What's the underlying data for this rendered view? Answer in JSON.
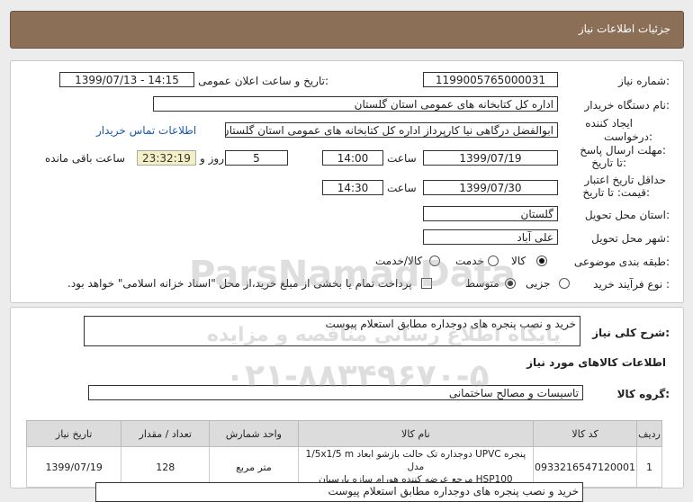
{
  "header": {
    "title": "جزئیات اطلاعات نیاز"
  },
  "fields": {
    "need_number_label": "شماره نیاز:",
    "need_number": "1199005765000031",
    "announce_label": "تاریخ و ساعت اعلان عمومی:",
    "announce_value": "1399/07/13 - 14:15",
    "buyer_label": "نام دستگاه خریدار:",
    "buyer_value": "اداره کل کتابخانه های عمومی استان گلستان",
    "creator_label_1": "ایجاد کننده",
    "creator_label_2": "درخواست:",
    "creator_value": "ابوالفضل  درگاهی نیا کارپرداز اداره کل کتابخانه های عمومی استان گلستان",
    "contact_link": "اطلاعات تماس خریدار",
    "deadline_label_1": "مهلت ارسال پاسخ:",
    "deadline_label_2": "تا تاریخ:",
    "deadline_date": "1399/07/19",
    "time_label": "ساعت",
    "deadline_time": "14:00",
    "days_value": "5",
    "days_label": "روز و",
    "remaining_time": "23:32:19",
    "remaining_label": "ساعت باقی مانده",
    "validity_label_1": "حداقل تاریخ اعتبار",
    "validity_label_2": "قیمت: تا تاریخ:",
    "validity_date": "1399/07/30",
    "validity_time_label": "ساعت",
    "validity_time": "14:30",
    "province_label": "استان محل تحویل:",
    "province_value": "گلستان",
    "city_label": "شهر محل تحویل:",
    "city_value": "علی آباد",
    "category_label": "طبقه بندی موضوعی:",
    "category_options": [
      "کالا",
      "خدمت",
      "کالا/خدمت"
    ],
    "category_selected": "کالا",
    "process_label": "نوع فرآیند خرید :",
    "process_options": [
      "جزیی",
      "متوسط"
    ],
    "process_selected": "متوسط",
    "payment_note": "پرداخت تمام یا بخشی از مبلغ خرید،از محل \"اسناد خزانه اسلامی\" خواهد بود."
  },
  "summary": {
    "label": "شرح کلی نیاز:",
    "value": "خرید و نصب پنجره های دوجداره مطابق استعلام پیوست"
  },
  "goods": {
    "section_title": "اطلاعات کالاهای مورد نیاز",
    "group_label": "گروه کالا:",
    "group_value": "تاسیسات و مصالح ساختمانی",
    "columns": [
      "ردیف",
      "کد کالا",
      "نام کالا",
      "واحد شمارش",
      "تعداد / مقدار",
      "تاریخ نیاز"
    ],
    "rows": [
      {
        "row": "1",
        "code": "0933216547120001",
        "name_line1": "پنجره UPVC دوجداره تک حالت بازشو ابعاد 1/5x1/5 m مدل",
        "name_line2": "HSP100 مرجع عرضه کننده هورام سازه پارسیان",
        "unit": "متر مربع",
        "qty": "128",
        "date": "1399/07/19"
      }
    ]
  },
  "footer_partial": "خرید و نصب پنجره های دوجداره مطابق استعلام پیوست",
  "watermark": {
    "line1": "ParsNamadData",
    "line2": "پایگاه اطلاع رسانی مناقصه و مزایده",
    "line3": "۰۲۱-۸۸۳۴۹۶۷۰-۵"
  }
}
